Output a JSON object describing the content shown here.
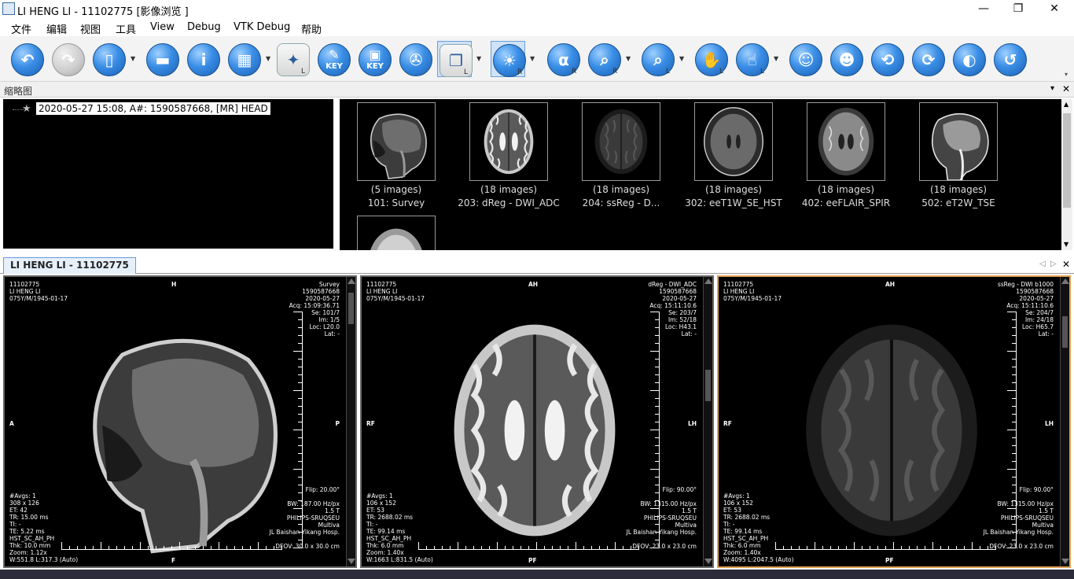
{
  "window": {
    "title": "LI HENG LI - 11102775 [影像浏览 ]",
    "controls": [
      "—",
      "❐",
      "✕"
    ]
  },
  "menu": [
    "文件",
    "编辑",
    "视图",
    "工具",
    "View",
    "Debug",
    "VTK Debug",
    "帮助"
  ],
  "toolbar": {
    "buttons": [
      {
        "icon": "back-arrow-icon",
        "glyph": "↶"
      },
      {
        "icon": "forward-arrow-icon",
        "glyph": "↷",
        "disabled": true
      },
      {
        "icon": "clipboard-icon",
        "glyph": "▯",
        "dropdown": true
      },
      {
        "icon": "series-strip-icon",
        "glyph": "▬"
      },
      {
        "icon": "info-icon",
        "glyph": "i"
      },
      {
        "icon": "layout-icon",
        "glyph": "▦",
        "dropdown": true
      },
      {
        "icon": "magic-wand-grid-icon",
        "glyph": "✦",
        "sub": "L"
      },
      {
        "icon": "key-pencil-icon",
        "glyph": "✎",
        "label": "KEY"
      },
      {
        "icon": "key-image-icon",
        "glyph": "▣",
        "label": "KEY"
      },
      {
        "icon": "film-reel-icon",
        "glyph": "✇"
      },
      {
        "icon": "stack-icon",
        "glyph": "❐",
        "sub": "L",
        "active": true,
        "dropdown": true
      },
      {
        "icon": "window-level-icon",
        "glyph": "☀",
        "sub": "R",
        "active": true,
        "dropdown": true
      },
      {
        "icon": "alpha-icon",
        "glyph": "α",
        "sub": "R"
      },
      {
        "icon": "zoom-icon",
        "glyph": "⌕",
        "sub": "R",
        "dropdown": true
      },
      {
        "icon": "magnifier-icon",
        "glyph": "⌕",
        "sub": "L",
        "dropdown": true
      },
      {
        "icon": "pan-hand-icon",
        "glyph": "✋",
        "sub": "L"
      },
      {
        "icon": "select-pointer-icon",
        "glyph": "☝",
        "sub": "L",
        "dropdown": true
      },
      {
        "icon": "person-icon",
        "glyph": "☺"
      },
      {
        "icon": "two-heads-icon",
        "glyph": "☻"
      },
      {
        "icon": "rotate-head-left-icon",
        "glyph": "⟲"
      },
      {
        "icon": "rotate-head-right-icon",
        "glyph": "⟳"
      },
      {
        "icon": "invert-icon",
        "glyph": "◐"
      },
      {
        "icon": "reset-icon",
        "glyph": "↺"
      }
    ]
  },
  "thumbnail_panel": {
    "header": "缩略图",
    "pin": "📌",
    "close": "✕",
    "study_node": "2020-05-27 15:08, A#: 1590587668, [MR] HEAD",
    "series": [
      {
        "count": "(5 images)",
        "name": "101: Survey",
        "kind": "sag"
      },
      {
        "count": "(18 images)",
        "name": "203: dReg - DWI_ADC",
        "kind": "adc"
      },
      {
        "count": "(18 images)",
        "name": "204: ssReg - D...",
        "kind": "dwi"
      },
      {
        "count": "(18 images)",
        "name": "302: eeT1W_SE_HST",
        "kind": "t1"
      },
      {
        "count": "(18 images)",
        "name": "402: eeFLAIR_SPIR",
        "kind": "flair"
      },
      {
        "count": "(18 images)",
        "name": "502: eT2W_TSE",
        "kind": "t2sag"
      },
      {
        "count": "",
        "name": "",
        "kind": "axial"
      }
    ]
  },
  "tab": {
    "label": "LI HENG LI - 11102775",
    "nav": [
      "◁",
      "▷",
      "✕"
    ]
  },
  "viewports": [
    {
      "patient": [
        "11102775",
        "LI HENG LI",
        "075Y/M/1945-01-17"
      ],
      "top_right": [
        "Survey",
        "1590587668",
        "2020-05-27",
        "Acq: 15:09:36.71",
        "Se: 101/7",
        "Im: 1/5",
        "Loc: L20.0",
        "Lat: -"
      ],
      "orient": {
        "top": "H",
        "bottom": "F",
        "left": "A",
        "right": "P"
      },
      "bottom_left": [
        "#Avgs: 1",
        "308 x 126",
        "ET: 42",
        "TR: 15.00 ms",
        "TI: -",
        "TE: 5.22 ms",
        "HST_SC_AH_PH",
        "Thk: 10.0 mm",
        "Zoom: 1.12x",
        "W:551.8 L:317.3 (Auto)"
      ],
      "bottom_right": [
        "Flip: 20.00°",
        "",
        "BW: 187.00 Hz/px",
        "1.5 T",
        "PHILIPS-SRUQSEU",
        "Multiva",
        "JL Baishan Yikang Hosp.",
        "",
        "DFOV: 30.0 x 30.0 cm"
      ],
      "image": "sag"
    },
    {
      "patient": [
        "11102775",
        "LI HENG LI",
        "075Y/M/1945-01-17"
      ],
      "top_right": [
        "dReg - DWI_ADC",
        "1590587668",
        "2020-05-27",
        "Acq: 15:11:10.6",
        "Se: 203/7",
        "Im: 52/18",
        "Loc: H43.1",
        "Lat: -"
      ],
      "orient": {
        "top": "AH",
        "bottom": "PF",
        "left": "RF",
        "right": "LH"
      },
      "bottom_left": [
        "#Avgs: 1",
        "106 x 152",
        "ET: 53",
        "TR: 2688.02 ms",
        "TI: -",
        "TE: 99.14 ms",
        "HST_SC_AH_PH",
        "Thk: 6.0 mm",
        "Zoom: 1.40x",
        "W:1663 L:831.5 (Auto)"
      ],
      "bottom_right": [
        "Flip: 90.00°",
        "",
        "BW: 1315.00 Hz/px",
        "1.5 T",
        "PHILIPS-SRUQSEU",
        "Multiva",
        "JL Baishan Yikang Hosp.",
        "",
        "DFOV: 23.0 x 23.0 cm"
      ],
      "image": "adc"
    },
    {
      "patient": [
        "11102775",
        "LI HENG LI",
        "075Y/M/1945-01-17"
      ],
      "top_right": [
        "ssReg - DWI b1000",
        "1590587668",
        "2020-05-27",
        "Acq: 15:11:10.6",
        "Se: 204/7",
        "Im: 24/18",
        "Loc: H65.7",
        "Lat: -"
      ],
      "orient": {
        "top": "AH",
        "bottom": "PF",
        "left": "RF",
        "right": "LH"
      },
      "bottom_left": [
        "#Avgs: 1",
        "106 x 152",
        "ET: 53",
        "TR: 2688.02 ms",
        "TI: -",
        "TE: 99.14 ms",
        "HST_SC_AH_PH",
        "Thk: 6.0 mm",
        "Zoom: 1.40x",
        "W:4095 L:2047.5 (Auto)"
      ],
      "bottom_right": [
        "Flip: 90.00°",
        "",
        "BW: 1315.00 Hz/px",
        "1.5 T",
        "PHILIPS-SRUQSEU",
        "Multiva",
        "JL Baishan Yikang Hosp.",
        "",
        "DFOV: 23.0 x 23.0 cm"
      ],
      "image": "dwi"
    }
  ],
  "colors": {
    "active_border": "#e0a050",
    "viewer_border": "#666666",
    "accent": "#3a8ee6"
  }
}
